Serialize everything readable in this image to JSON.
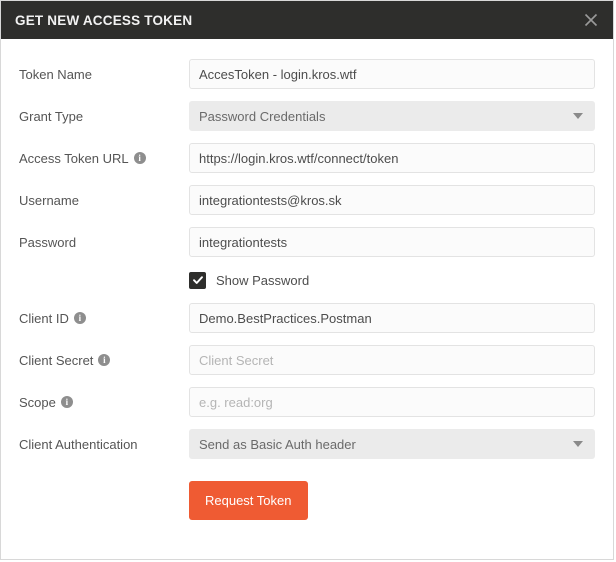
{
  "dialog": {
    "title": "GET NEW ACCESS TOKEN",
    "close_icon": "close-icon"
  },
  "colors": {
    "header_bg": "#2e2e2c",
    "accent_button": "#ef5b33",
    "field_bg": "#fbfbfb",
    "select_bg": "#ebebeb",
    "label_text": "#555555"
  },
  "form": {
    "rows": [
      {
        "label": "Token Name",
        "info": false,
        "type": "text",
        "value": "AccesToken - login.kros.wtf",
        "placeholder": ""
      },
      {
        "label": "Grant Type",
        "info": false,
        "type": "select",
        "value": "Password Credentials",
        "placeholder": ""
      },
      {
        "label": "Access Token URL",
        "info": true,
        "type": "text",
        "value": "https://login.kros.wtf/connect/token",
        "placeholder": ""
      },
      {
        "label": "Username",
        "info": false,
        "type": "text",
        "value": "integrationtests@kros.sk",
        "placeholder": ""
      },
      {
        "label": "Password",
        "info": false,
        "type": "text",
        "value": "integrationtests",
        "placeholder": ""
      }
    ],
    "show_password": {
      "label": "Show Password",
      "checked": true
    },
    "rows2": [
      {
        "label": "Client ID",
        "info": true,
        "type": "text",
        "value": "Demo.BestPractices.Postman",
        "placeholder": ""
      },
      {
        "label": "Client Secret",
        "info": true,
        "type": "text",
        "value": "",
        "placeholder": "Client Secret"
      },
      {
        "label": "Scope",
        "info": true,
        "type": "text",
        "value": "",
        "placeholder": "e.g. read:org"
      },
      {
        "label": "Client Authentication",
        "info": false,
        "type": "select",
        "value": "Send as Basic Auth header",
        "placeholder": ""
      }
    ],
    "submit_label": "Request Token"
  }
}
